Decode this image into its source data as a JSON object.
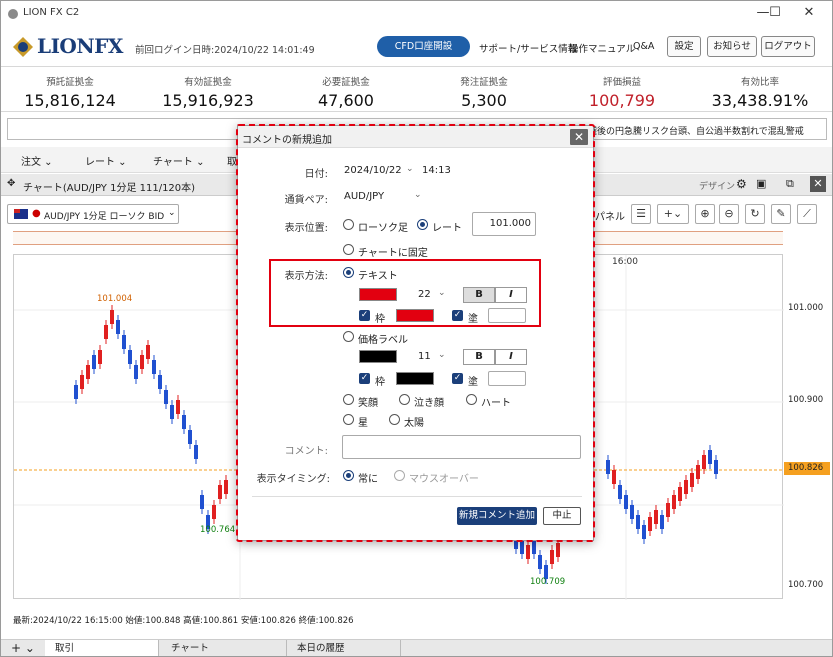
{
  "app": {
    "title": "LION FX C2",
    "logo_text": "LIONFX",
    "last_login": "前回ログイン日時:2024/10/22 14:01:49"
  },
  "header": {
    "cfd_button": "CFD口座開設",
    "links": [
      "サポート/サービス情報",
      "操作マニュアル",
      "Q&A"
    ],
    "buttons": [
      "設定",
      "お知らせ",
      "ログアウト"
    ]
  },
  "stats": [
    {
      "label": "預託証拠金",
      "value": "15,816,124"
    },
    {
      "label": "有効証拠金",
      "value": "15,916,923"
    },
    {
      "label": "必要証拠金",
      "value": "47,600"
    },
    {
      "label": "発注証拠金",
      "value": "5,300"
    },
    {
      "label": "評価損益",
      "value": "100,799"
    },
    {
      "label": "有効比率",
      "value": "33,438.91%"
    }
  ],
  "news_text": "選後の円急騰リスク台頭、自公過半数割れで混乱警戒",
  "menu": [
    "注文",
    "レート",
    "チャート",
    "取"
  ],
  "chart": {
    "window_title": "チャート(AUD/JPY 1分足 111/120本)",
    "design_label": "デザイン",
    "symbol": "AUD/JPY 1分足 ローソク BID",
    "panel_label": "パネル",
    "time_label": "16:00",
    "y_ticks": [
      "101.000",
      "100.900",
      "100.826",
      "100.700"
    ],
    "high_label": "101.004",
    "low_label": "100.764",
    "low_label_2": "100.709",
    "info": "最新:2024/10/22 16:15:00 始値:100.848 高値:100.861 安値:100.826 終値:100.826",
    "colors": {
      "up": "#e02020",
      "down": "#2050d0",
      "current": "#f5a020"
    }
  },
  "bottom_tabs": [
    "取引",
    "チャート",
    "本日の履歴"
  ],
  "dialog": {
    "title": "コメントの新規追加",
    "date_label": "日付:",
    "date_value": "2024/10/22",
    "time_value": "14:13",
    "pair_label": "通貨ペア:",
    "pair_value": "AUD/JPY",
    "position_label": "表示位置:",
    "pos_candle": "ローソク足",
    "pos_rate": "レート",
    "rate_value": "101.000",
    "pos_fixed": "チャートに固定",
    "method_label": "表示方法:",
    "text_option": "テキスト",
    "text_size": "22",
    "frame_label": "枠",
    "fill_label": "塗",
    "bold_label": "B",
    "italic_label": "I",
    "price_label_option": "価格ラベル",
    "price_size": "11",
    "icons": [
      "笑顔",
      "泣き顔",
      "ハート",
      "星",
      "太陽"
    ],
    "comment_label": "コメント:",
    "comment_value": "",
    "timing_label": "表示タイミング:",
    "timing_always": "常に",
    "timing_hover": "マウスオーバー",
    "add_button": "新規コメント追加",
    "cancel_button": "中止",
    "colors": {
      "text_color": "#e20010",
      "frame_color": "#e20010",
      "label_color": "#000000",
      "highlight": "#e20010"
    }
  }
}
